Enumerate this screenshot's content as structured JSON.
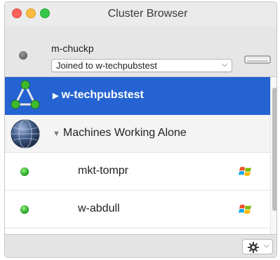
{
  "window": {
    "title": "Cluster Browser"
  },
  "header": {
    "computer_name": "m-chuckp",
    "cluster_select": {
      "selected": "Joined to w-techpubstest"
    },
    "status": "offline"
  },
  "list": {
    "rows": [
      {
        "label": "w-techpubstest",
        "kind": "cluster",
        "icon": "network-triangle-icon",
        "expanded": false,
        "selected": true
      },
      {
        "label": "Machines Working Alone",
        "kind": "group",
        "icon": "globe-icon",
        "expanded": true,
        "selected": false
      },
      {
        "label": "mkt-tompr",
        "kind": "machine",
        "status": "online",
        "os": "windows-logo-icon"
      },
      {
        "label": "w-abdull",
        "kind": "machine",
        "status": "online",
        "os": "windows-logo-icon"
      }
    ]
  },
  "footer": {
    "action_menu_icon": "gear-icon"
  },
  "colors": {
    "selection": "#2463d1",
    "online": "#2fbf2a",
    "offline": "#5a5a5a"
  }
}
